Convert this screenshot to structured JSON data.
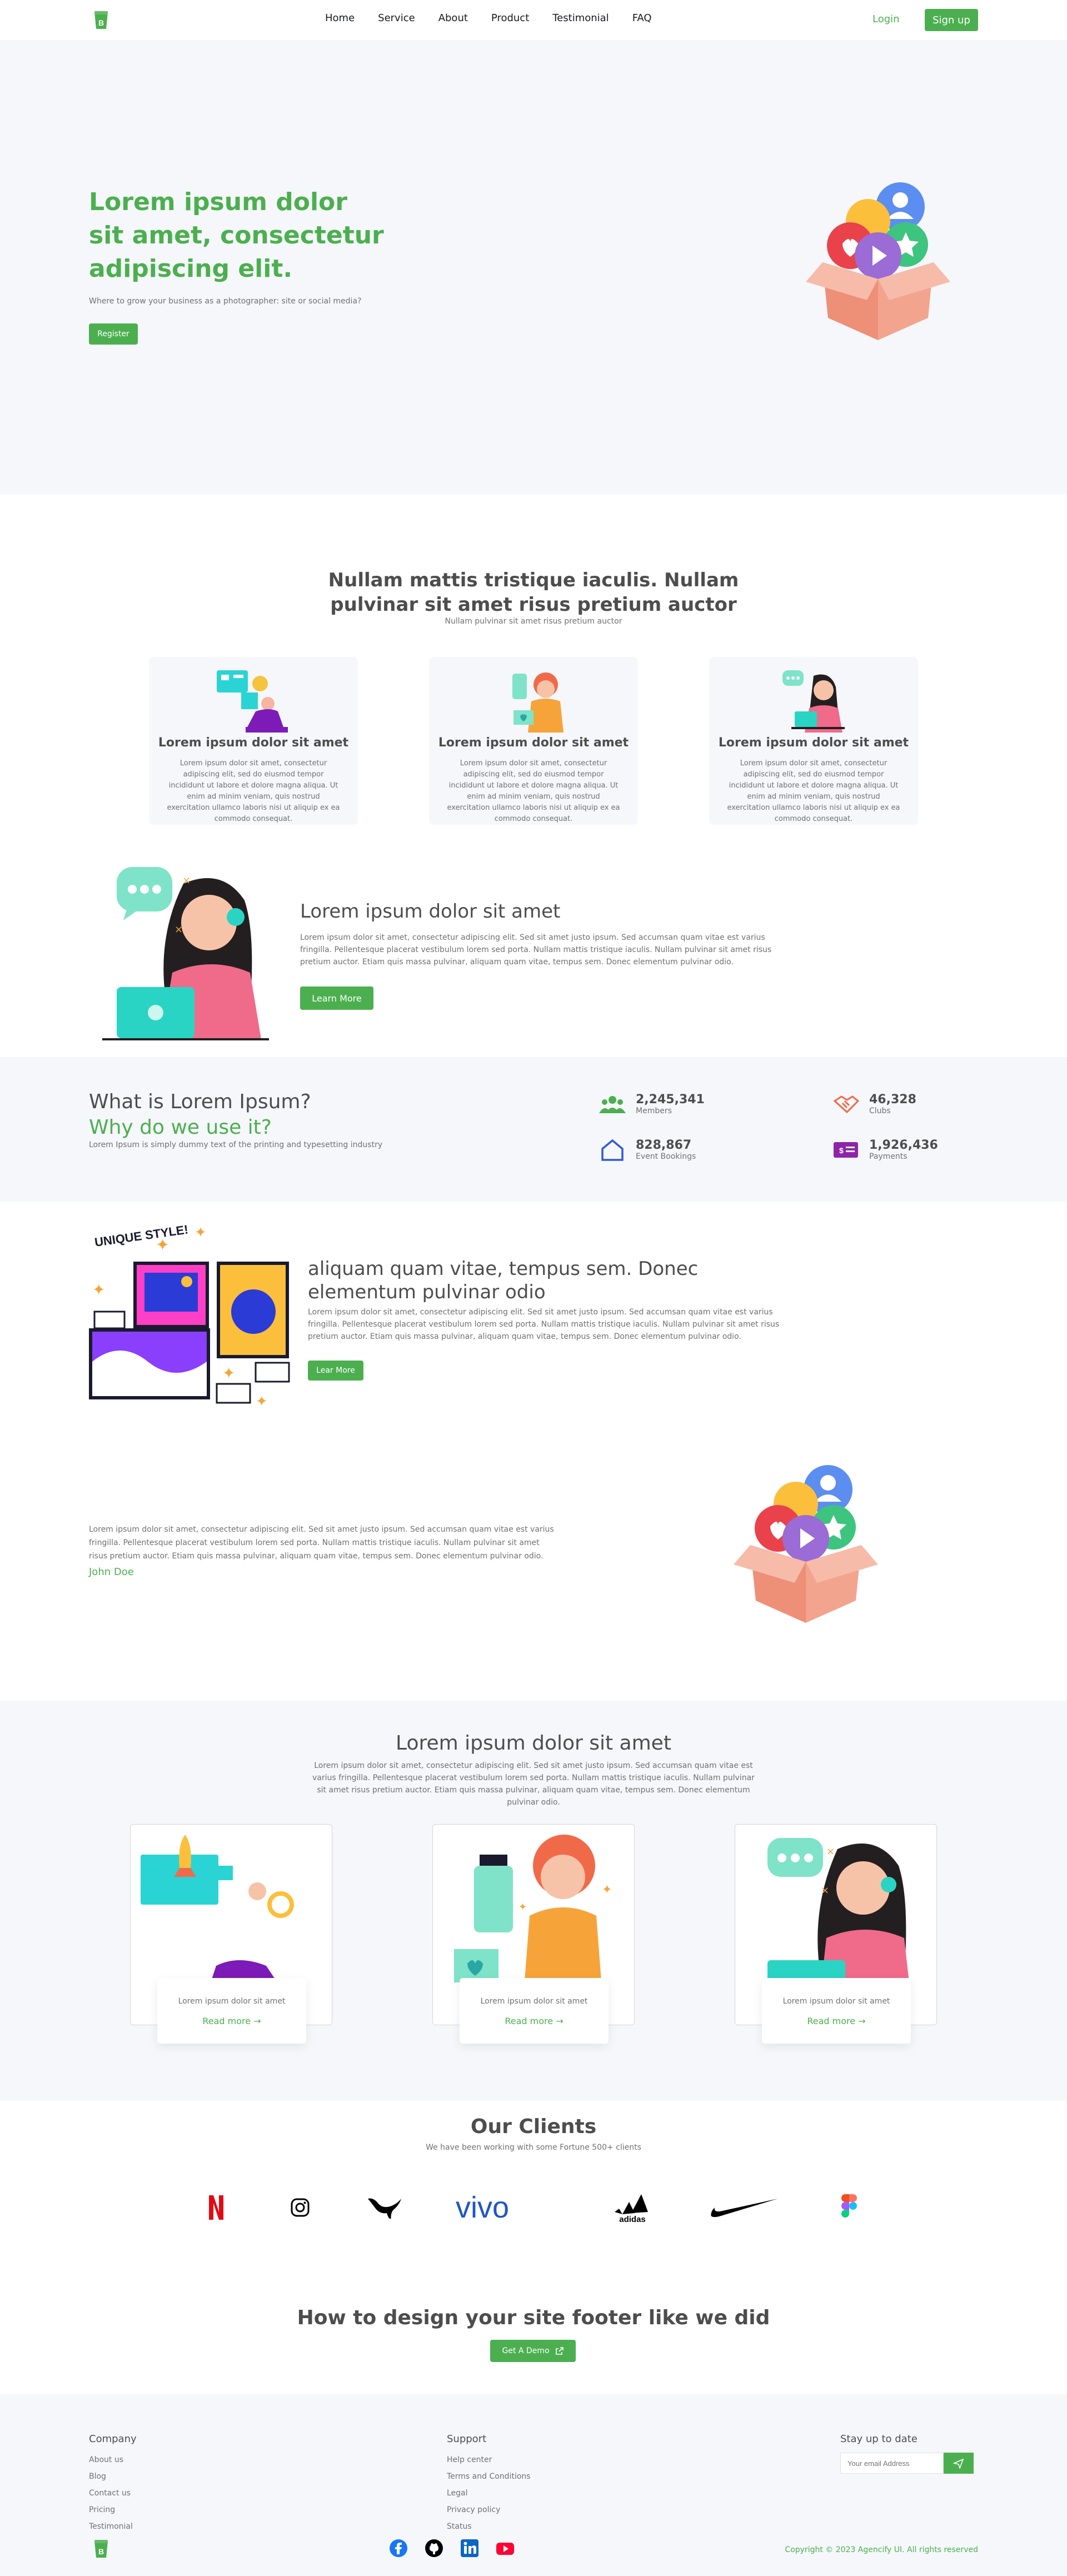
{
  "nav": {
    "links": [
      "Home",
      "Service",
      "About",
      "Product",
      "Testimonial",
      "FAQ"
    ],
    "login": "Login",
    "signup": "Sign up"
  },
  "hero": {
    "title": "Lorem ipsum dolor sit amet, consectetur adipiscing elit.",
    "subtitle": "Where to grow your business as a photographer: site or social media?",
    "cta": "Register"
  },
  "features": {
    "title": "Nullam mattis tristique iaculis. Nullam pulvinar sit amet risus pretium auctor",
    "subtitle": "Nullam pulvinar sit amet risus pretium auctor",
    "cards": [
      {
        "title": "Lorem ipsum dolor sit amet",
        "text": "Lorem ipsum dolor sit amet, consectetur adipiscing elit, sed do eiusmod tempor incididunt ut labore et dolore magna aliqua. Ut enim ad minim veniam, quis nostrud exercitation ullamco laboris nisi ut aliquip ex ea commodo consequat."
      },
      {
        "title": "Lorem ipsum dolor sit amet",
        "text": "Lorem ipsum dolor sit amet, consectetur adipiscing elit, sed do eiusmod tempor incididunt ut labore et dolore magna aliqua. Ut enim ad minim veniam, quis nostrud exercitation ullamco laboris nisi ut aliquip ex ea commodo consequat."
      },
      {
        "title": "Lorem ipsum dolor sit amet",
        "text": "Lorem ipsum dolor sit amet, consectetur adipiscing elit, sed do eiusmod tempor incididunt ut labore et dolore magna aliqua. Ut enim ad minim veniam, quis nostrud exercitation ullamco laboris nisi ut aliquip ex ea commodo consequat."
      }
    ]
  },
  "about": {
    "title": "Lorem ipsum dolor sit amet",
    "text": "Lorem ipsum dolor sit amet, consectetur adipiscing elit. Sed sit amet justo ipsum. Sed accumsan quam vitae est varius fringilla. Pellentesque placerat vestibulum lorem sed porta. Nullam mattis tristique iaculis. Nullam pulvinar sit amet risus pretium auctor. Etiam quis massa pulvinar, aliquam quam vitae, tempus sem. Donec elementum pulvinar odio.",
    "cta": "Learn More"
  },
  "stats": {
    "title_line1": "What is Lorem Ipsum?",
    "title_line2": "Why do we use it?",
    "text": "Lorem Ipsum is simply dummy text of the printing and typesetting industry",
    "items": [
      {
        "value": "2,245,341",
        "label": "Members"
      },
      {
        "value": "46,328",
        "label": "Clubs"
      },
      {
        "value": "828,867",
        "label": "Event Bookings"
      },
      {
        "value": "1,926,436",
        "label": "Payments"
      }
    ]
  },
  "unique": {
    "badge": "UNIQUE STYLE!",
    "title": "aliquam quam vitae, tempus sem. Donec elementum pulvinar odio",
    "text": "Lorem ipsum dolor sit amet, consectetur adipiscing elit. Sed sit amet justo ipsum. Sed accumsan quam vitae est varius fringilla. Pellentesque placerat vestibulum lorem sed porta. Nullam mattis tristique iaculis. Nullam pulvinar sit amet risus pretium auctor. Etiam quis massa pulvinar, aliquam quam vitae, tempus sem. Donec elementum pulvinar odio.",
    "cta": "Lear More"
  },
  "testimonial": {
    "text": "Lorem ipsum dolor sit amet, consectetur adipiscing elit. Sed sit amet justo ipsum. Sed accumsan quam vitae est varius fringilla. Pellentesque placerat vestibulum lorem sed porta. Nullam mattis tristique iaculis. Nullam pulvinar sit amet risus pretium auctor. Etiam quis massa pulvinar, aliquam quam vitae, tempus sem. Donec elementum pulvinar odio.",
    "name": "John Doe"
  },
  "blog": {
    "title": "Lorem ipsum dolor sit amet",
    "text": "Lorem ipsum dolor sit amet, consectetur adipiscing elit. Sed sit amet justo ipsum. Sed accumsan quam vitae est varius fringilla. Pellentesque placerat vestibulum lorem sed porta. Nullam mattis tristique iaculis. Nullam pulvinar sit amet risus pretium auctor. Etiam quis massa pulvinar, aliquam quam vitae, tempus sem. Donec elementum pulvinar odio.",
    "cards": [
      {
        "text": "Lorem ipsum dolor sit amet",
        "link": "Read more"
      },
      {
        "text": "Lorem ipsum dolor sit amet",
        "link": "Read more"
      },
      {
        "text": "Lorem ipsum dolor sit amet",
        "link": "Read more"
      }
    ]
  },
  "clients": {
    "title": "Our Clients",
    "subtitle": "We have been working with some Fortune 500+ clients",
    "logos": [
      "netflix-logo",
      "instagram-logo",
      "puma-logo",
      "vivo-logo",
      "adidas-logo",
      "nike-logo",
      "figma-logo"
    ],
    "vivo": "vivo",
    "adidas": "adidas"
  },
  "cta": {
    "title": "How to design your site footer like we did",
    "button": "Get A Demo"
  },
  "footer": {
    "company_title": "Company",
    "company_links": [
      "About us",
      "Blog",
      "Contact us",
      "Pricing",
      "Testimonial"
    ],
    "support_title": "Support",
    "support_links": [
      "Help center",
      "Terms and Conditions",
      "Legal",
      "Privacy policy",
      "Status"
    ],
    "subscribe_title": "Stay up to date",
    "email_placeholder": "Your email Address",
    "copyright": "Copyright © 2023 Agencify UI. All rights reserved"
  },
  "colors": {
    "accent": "#4caf4f",
    "bg_soft": "#f5f7fa",
    "text": "#4d4d4d",
    "muted": "#717171"
  }
}
